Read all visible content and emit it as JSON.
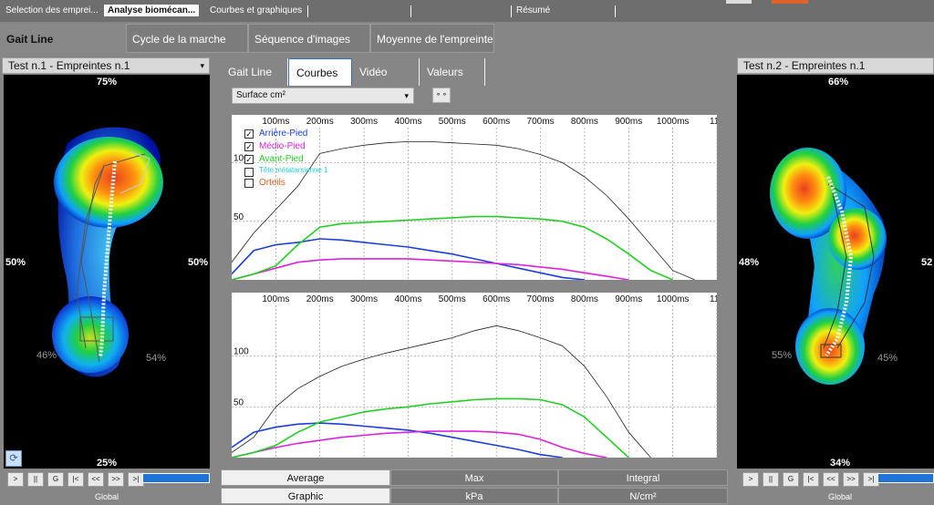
{
  "top_tabs": [
    {
      "label": "Selection des emprei..."
    },
    {
      "label": "Analyse biomécan..."
    },
    {
      "label": "Courbes et graphiques"
    },
    {
      "label": "Résumé"
    }
  ],
  "sub_tabs": [
    "Gait Line",
    "Cycle de la marche",
    "Séquence d'images",
    "Moyenne de l'empreinte"
  ],
  "left_panel": {
    "title": "Test n.1 - Empreintes n.1",
    "top_pct": "75%",
    "left_pct": "50%",
    "right_pct": "50%",
    "lower_left_pct": "46%",
    "lower_right_pct": "54%",
    "bottom_pct": "25%"
  },
  "right_panel": {
    "title": "Test n.2 - Empreintes n.1",
    "top_pct": "66%",
    "left_pct": "48%",
    "right_pct": "52",
    "lower_left_pct": "55%",
    "lower_right_pct": "45%",
    "bottom_pct": "34%"
  },
  "center_tabs": [
    "Gait Line",
    "Courbes",
    "Vidéo",
    "Valeurs"
  ],
  "metric_select": "Surface cm²",
  "legend": [
    {
      "label": "Arrière-Pied",
      "checked": true,
      "color": "#1a3ee0"
    },
    {
      "label": "Médio-Pied",
      "checked": true,
      "color": "#e020e0"
    },
    {
      "label": "Avant-Pied",
      "checked": true,
      "color": "#20d020"
    },
    {
      "label": "Tête métatarsienne 1",
      "checked": false,
      "color": "#20d0e0"
    },
    {
      "label": "Orteils",
      "checked": false,
      "color": "#e06020"
    }
  ],
  "bottom_tabs": {
    "row1": [
      "Average",
      "Max",
      "Integral"
    ],
    "row2": [
      "Graphic",
      "kPa",
      "N/cm²"
    ]
  },
  "controls": [
    ">",
    "||",
    "G",
    "|<",
    "<<",
    ">>",
    ">|"
  ],
  "global_label": "Global",
  "chart_data": [
    {
      "type": "line",
      "x_ticks": [
        "100ms",
        "200ms",
        "300ms",
        "400ms",
        "500ms",
        "600ms",
        "700ms",
        "800ms",
        "900ms",
        "1000ms",
        "110"
      ],
      "y_ticks": [
        "100",
        "50"
      ],
      "xlim": [
        0,
        1100
      ],
      "ylim": [
        0,
        130
      ],
      "series": [
        {
          "name": "Total",
          "color": "#222222",
          "x": [
            0,
            50,
            100,
            150,
            200,
            250,
            300,
            350,
            400,
            450,
            500,
            550,
            600,
            650,
            700,
            750,
            800,
            850,
            900,
            950,
            1000,
            1050
          ],
          "y": [
            15,
            40,
            60,
            80,
            108,
            112,
            115,
            117,
            118,
            118,
            117,
            116,
            115,
            112,
            107,
            100,
            88,
            72,
            52,
            30,
            8,
            0
          ]
        },
        {
          "name": "Arrière-Pied",
          "color": "#1a3ee0",
          "x": [
            0,
            50,
            100,
            150,
            200,
            250,
            300,
            350,
            400,
            450,
            500,
            550,
            600,
            650,
            700,
            750,
            800
          ],
          "y": [
            5,
            25,
            30,
            32,
            35,
            34,
            32,
            30,
            28,
            25,
            22,
            18,
            14,
            10,
            6,
            2,
            0
          ]
        },
        {
          "name": "Médio-Pied",
          "color": "#e020e0",
          "x": [
            0,
            50,
            100,
            150,
            200,
            250,
            300,
            350,
            400,
            450,
            500,
            550,
            600,
            650,
            700,
            750,
            800,
            850,
            900
          ],
          "y": [
            0,
            5,
            10,
            15,
            17,
            18,
            18,
            18,
            18,
            17,
            16,
            15,
            14,
            13,
            11,
            9,
            6,
            3,
            0
          ]
        },
        {
          "name": "Avant-Pied",
          "color": "#20d020",
          "x": [
            0,
            50,
            100,
            150,
            200,
            250,
            300,
            350,
            400,
            450,
            500,
            550,
            600,
            650,
            700,
            750,
            800,
            850,
            900,
            950,
            1000
          ],
          "y": [
            0,
            5,
            12,
            30,
            45,
            48,
            49,
            50,
            51,
            52,
            53,
            54,
            54,
            53,
            52,
            50,
            45,
            35,
            22,
            8,
            0
          ]
        }
      ]
    },
    {
      "type": "line",
      "x_ticks": [
        "100ms",
        "200ms",
        "300ms",
        "400ms",
        "500ms",
        "600ms",
        "700ms",
        "800ms",
        "900ms",
        "1000ms",
        "110"
      ],
      "y_ticks": [
        "100",
        "50"
      ],
      "xlim": [
        0,
        1100
      ],
      "ylim": [
        0,
        150
      ],
      "series": [
        {
          "name": "Total",
          "color": "#222222",
          "x": [
            0,
            50,
            100,
            150,
            200,
            250,
            300,
            350,
            400,
            450,
            500,
            550,
            600,
            650,
            700,
            750,
            800,
            850,
            900,
            950
          ],
          "y": [
            5,
            20,
            50,
            68,
            80,
            90,
            97,
            103,
            108,
            113,
            118,
            125,
            130,
            125,
            118,
            110,
            90,
            60,
            25,
            0
          ]
        },
        {
          "name": "Arrière-Pied",
          "color": "#1a3ee0",
          "x": [
            0,
            50,
            100,
            150,
            200,
            250,
            300,
            350,
            400,
            450,
            500,
            550,
            600,
            650,
            700,
            750
          ],
          "y": [
            10,
            25,
            30,
            33,
            34,
            33,
            31,
            29,
            27,
            24,
            20,
            16,
            12,
            8,
            3,
            0
          ]
        },
        {
          "name": "Médio-Pied",
          "color": "#e020e0",
          "x": [
            0,
            50,
            100,
            150,
            200,
            250,
            300,
            350,
            400,
            450,
            500,
            550,
            600,
            650,
            700,
            750,
            800,
            850
          ],
          "y": [
            0,
            5,
            10,
            14,
            17,
            20,
            22,
            24,
            25,
            26,
            26,
            26,
            25,
            23,
            18,
            10,
            4,
            0
          ]
        },
        {
          "name": "Avant-Pied",
          "color": "#20d020",
          "x": [
            0,
            50,
            100,
            150,
            200,
            250,
            300,
            350,
            400,
            450,
            500,
            550,
            600,
            650,
            700,
            750,
            800,
            850,
            900
          ],
          "y": [
            0,
            5,
            12,
            25,
            35,
            40,
            45,
            48,
            50,
            53,
            55,
            57,
            58,
            58,
            57,
            52,
            40,
            20,
            0
          ]
        }
      ]
    }
  ]
}
